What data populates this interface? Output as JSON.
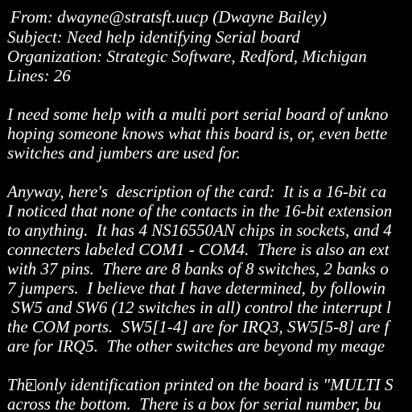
{
  "header": {
    "from": "From: dwayne@stratsft.uucp (Dwayne Bailey)",
    "subject": "Subject: Need help identifying Serial board",
    "organization": "Organization: Strategic Software, Redford, Michigan",
    "lines": "Lines: 26"
  },
  "body": {
    "para1": [
      "I need some help with a multi port serial board of unkno",
      "hoping someone knows what this board is, or, even bette",
      "switches and jumbers are used for."
    ],
    "para2": [
      "Anyway, here's  description of the card:  It is a 16-bit ca",
      "I noticed that none of the contacts in the 16-bit extension",
      "to anything.  It has 4 NS16550AN chips in sockets, and 4",
      "connecters labeled COM1 - COM4.  There is also an ext",
      "with 37 pins.  There are 8 banks of 8 switches, 2 banks o",
      "7 jumpers.  I believe that I have determined, by followin",
      " SW5 and SW6 (12 switches in all) control the interrupt l",
      "the COM ports.  SW5[1-4] are for IRQ3, SW5[5-8] are f",
      "are for IRQ5.  The other switches are beyond my meage"
    ],
    "box_icon": "empty-box-glyph",
    "para3": [
      "The only identification printed on the board is \"MULTI S",
      "across the bottom.  There is a box for serial number, bu"
    ]
  }
}
